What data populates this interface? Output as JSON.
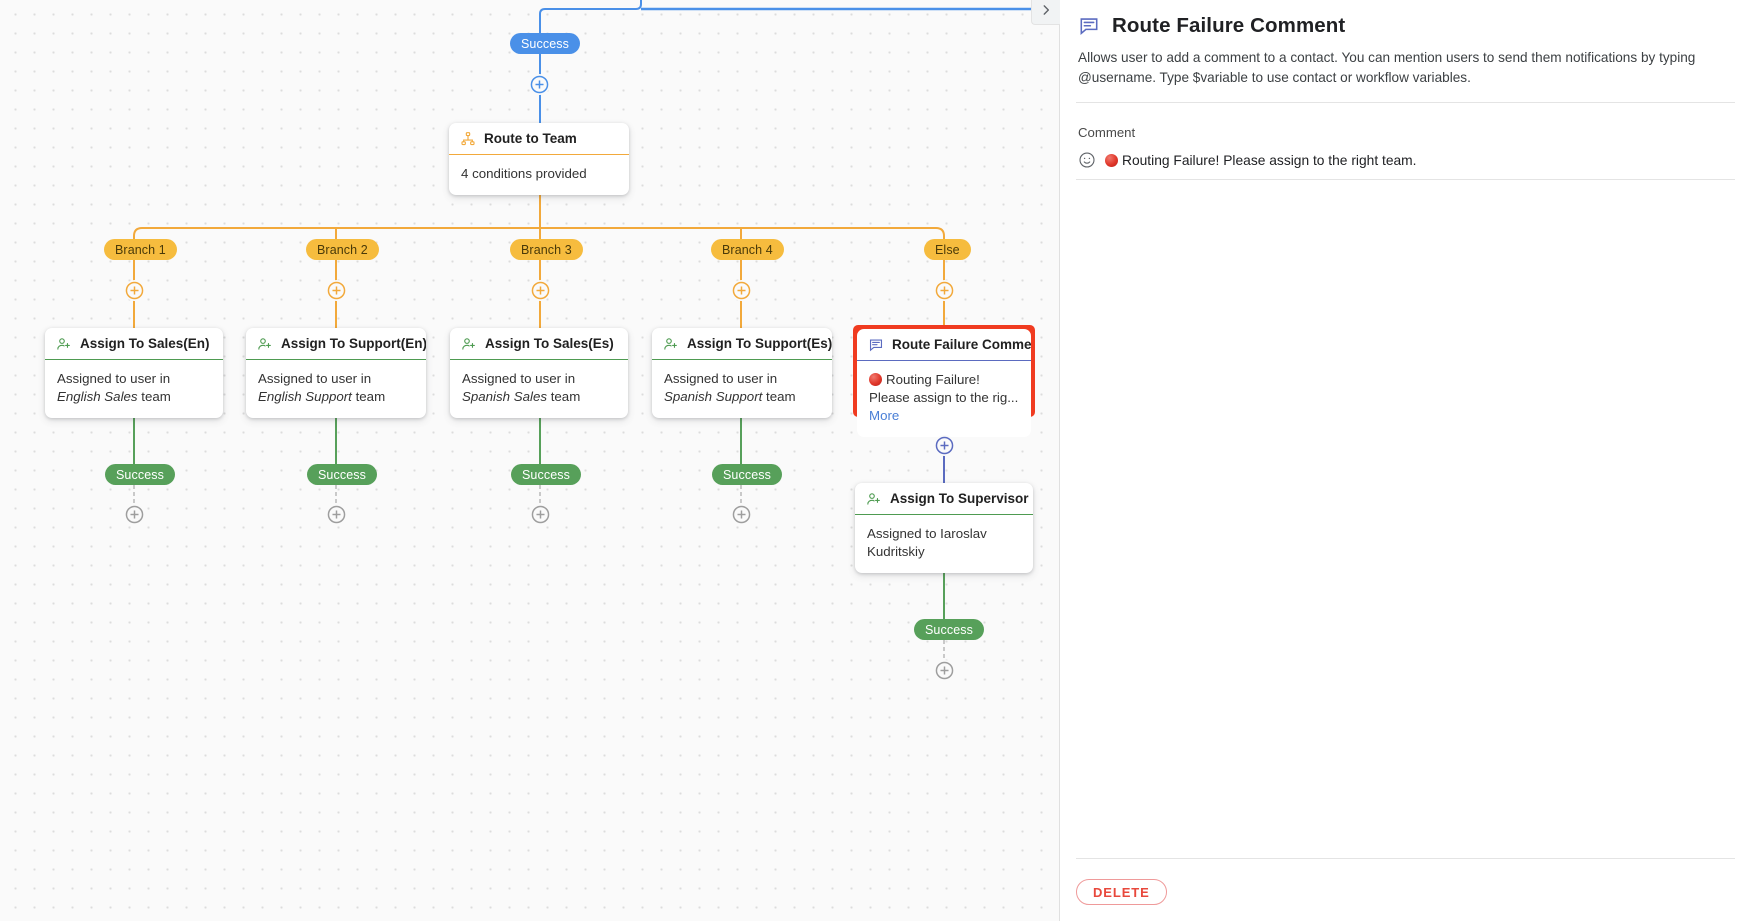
{
  "canvas": {
    "collapse_icon": "chevron-right-icon",
    "top_badge": {
      "label": "Success",
      "color": "#4a90e8"
    },
    "route_node": {
      "icon": "org-chart-icon",
      "title": "Route to Team",
      "body": "4 conditions provided",
      "accent": "#f2a93b"
    },
    "branches": [
      {
        "label": "Branch 1"
      },
      {
        "label": "Branch 2"
      },
      {
        "label": "Branch 3"
      },
      {
        "label": "Branch 4"
      },
      {
        "label": "Else"
      }
    ],
    "branch_color": "#f6bc3e",
    "action_nodes": [
      {
        "icon": "assign-user-icon",
        "title": "Assign To Sales(En)",
        "body_pre": "Assigned to user in ",
        "body_em": "English Sales",
        "body_post": " team",
        "accent": "#4e9b51"
      },
      {
        "icon": "assign-user-icon",
        "title": "Assign To Support(En)",
        "body_pre": "Assigned to user in ",
        "body_em": "English Support",
        "body_post": " team",
        "accent": "#4e9b51"
      },
      {
        "icon": "assign-user-icon",
        "title": "Assign To Sales(Es)",
        "body_pre": "Assigned to user in ",
        "body_em": "Spanish Sales",
        "body_post": " team",
        "accent": "#4e9b51"
      },
      {
        "icon": "assign-user-icon",
        "title": "Assign To Support(Es)",
        "body_pre": "Assigned to user in ",
        "body_em": "Spanish Support",
        "body_post": " team",
        "accent": "#4e9b51"
      }
    ],
    "selected_node": {
      "icon": "comment-icon",
      "title": "Route Failure Comment",
      "body_text": "Routing Failure! Please assign to the rig...",
      "more_label": "More",
      "accent": "#5b6bc0",
      "selection_color": "#f03b20"
    },
    "supervisor_node": {
      "icon": "assign-user-icon",
      "title": "Assign To Supervisor",
      "body": "Assigned to Iaroslav Kudritskiy",
      "accent": "#4e9b51"
    },
    "success_badges": [
      {
        "label": "Success"
      },
      {
        "label": "Success"
      },
      {
        "label": "Success"
      },
      {
        "label": "Success"
      },
      {
        "label": "Success"
      }
    ],
    "success_color": "#57a05a",
    "add_step_icon": "plus-circle-icon"
  },
  "panel": {
    "icon": "comment-icon",
    "title": "Route Failure Comment",
    "description": "Allows user to add a comment to a contact. You can mention users to send them notifications by typing @username. Type $variable to use contact or workflow variables.",
    "comment_field": {
      "label": "Comment",
      "emoji_icon": "smiley-icon",
      "value": "Routing Failure! Please assign to the right team."
    },
    "delete_label": "DELETE",
    "delete_color": "#e8483c"
  }
}
